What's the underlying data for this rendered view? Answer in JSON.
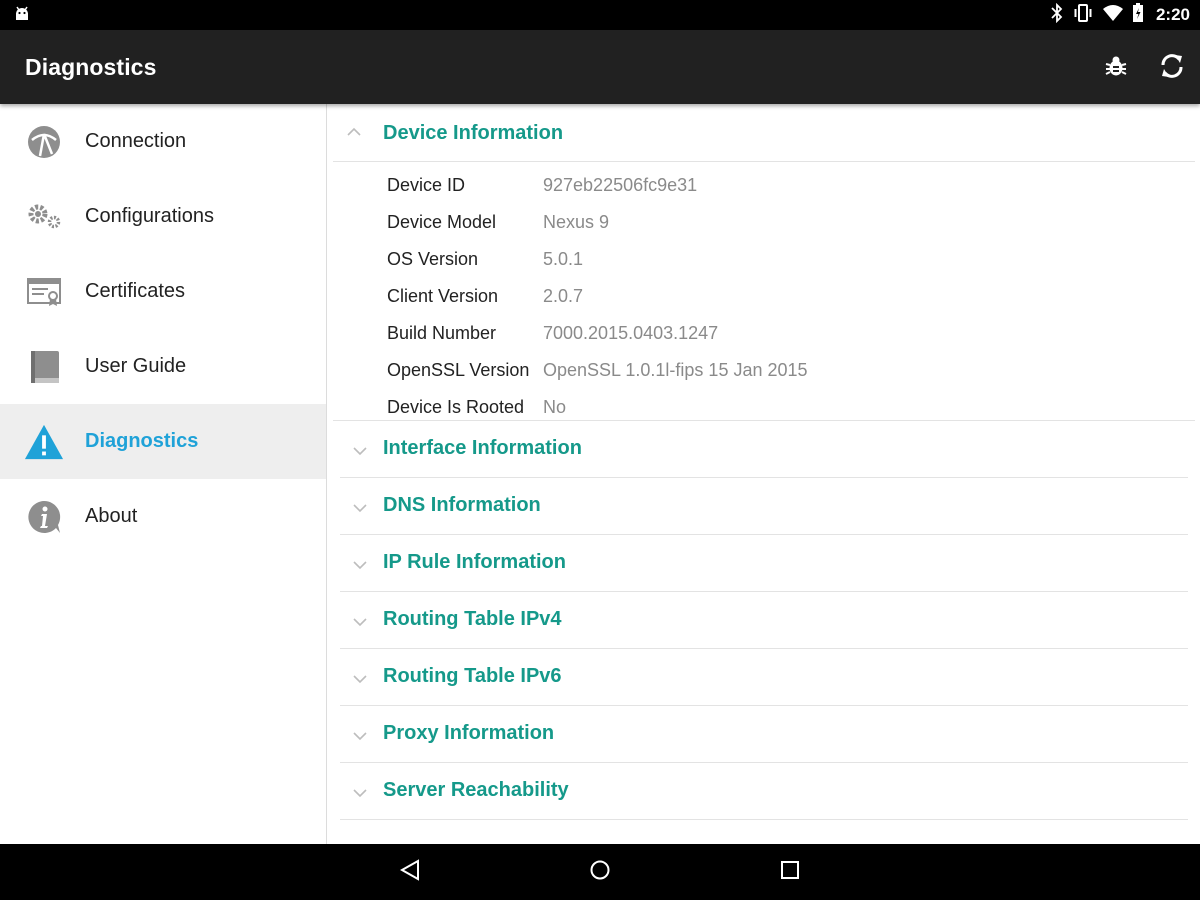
{
  "status_bar": {
    "time": "2:20",
    "icons": [
      "android-icon",
      "bluetooth-icon",
      "vibrate-icon",
      "wifi-icon",
      "battery-icon"
    ]
  },
  "app_bar": {
    "title": "Diagnostics",
    "actions": [
      "bug-icon",
      "refresh-icon"
    ]
  },
  "sidebar": {
    "items": [
      {
        "label": "Connection",
        "icon": "connection-icon"
      },
      {
        "label": "Configurations",
        "icon": "gears-icon"
      },
      {
        "label": "Certificates",
        "icon": "certificate-icon"
      },
      {
        "label": "User Guide",
        "icon": "book-icon"
      },
      {
        "label": "Diagnostics",
        "icon": "warning-icon",
        "active": true
      },
      {
        "label": "About",
        "icon": "info-icon"
      }
    ]
  },
  "main": {
    "expanded_section": {
      "title": "Device Information",
      "rows": [
        {
          "key": "Device ID",
          "value": "927eb22506fc9e31"
        },
        {
          "key": "Device Model",
          "value": "Nexus 9"
        },
        {
          "key": "OS Version",
          "value": "5.0.1"
        },
        {
          "key": "Client Version",
          "value": "2.0.7"
        },
        {
          "key": "Build Number",
          "value": "7000.2015.0403.1247"
        },
        {
          "key": "OpenSSL Version",
          "value": "OpenSSL 1.0.1l-fips 15 Jan 2015"
        },
        {
          "key": "Device Is Rooted",
          "value": "No"
        }
      ]
    },
    "sections": [
      "Interface Information",
      "DNS Information",
      "IP Rule Information",
      "Routing Table IPv4",
      "Routing Table IPv6",
      "Proxy Information",
      "Server Reachability"
    ]
  },
  "colors": {
    "accent_teal": "#15998a",
    "active_blue": "#1fa2d8",
    "app_bar": "#212121"
  }
}
